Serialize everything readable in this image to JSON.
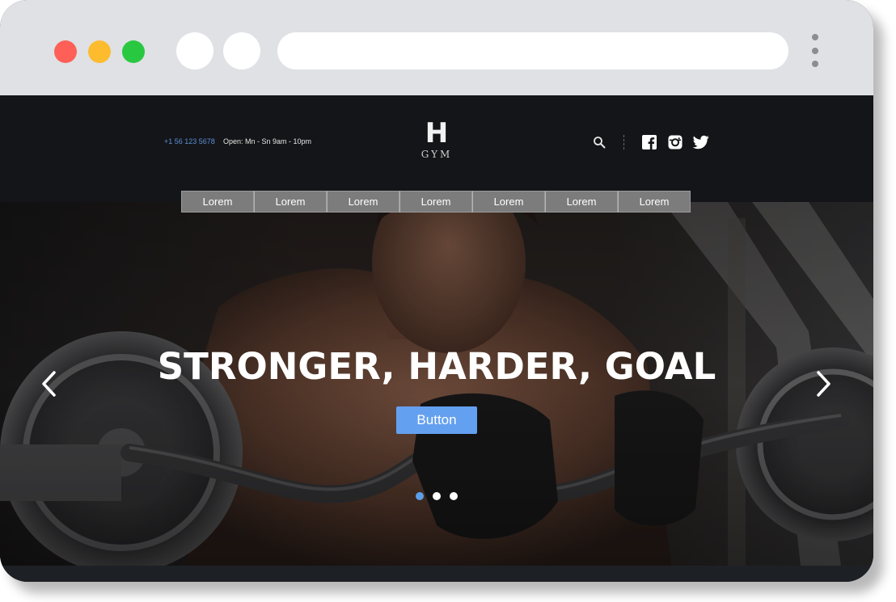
{
  "browser": {
    "colors": {
      "close": "#fe5f57",
      "minimize": "#fdbc2e",
      "maximize": "#28c840",
      "chrome_bg": "#dfe1e5"
    },
    "url": ""
  },
  "header": {
    "phone": "+1 56 123 5678",
    "hours": "Open: Mn - Sn 9am - 10pm",
    "logo_letter": "H",
    "logo_text": "GYM",
    "icons": [
      "search-icon",
      "facebook-icon",
      "instagram-icon",
      "twitter-icon"
    ]
  },
  "nav": {
    "items": [
      {
        "label": "Lorem"
      },
      {
        "label": "Lorem"
      },
      {
        "label": "Lorem"
      },
      {
        "label": "Lorem"
      },
      {
        "label": "Lorem"
      },
      {
        "label": "Lorem"
      },
      {
        "label": "Lorem"
      }
    ]
  },
  "hero": {
    "headline": "STRONGER, HARDER, GOAL",
    "button_label": "Button",
    "slides_total": 3,
    "active_slide": 1,
    "colors": {
      "button": "#64a0f0",
      "active_dot": "#5b9fe8"
    }
  }
}
